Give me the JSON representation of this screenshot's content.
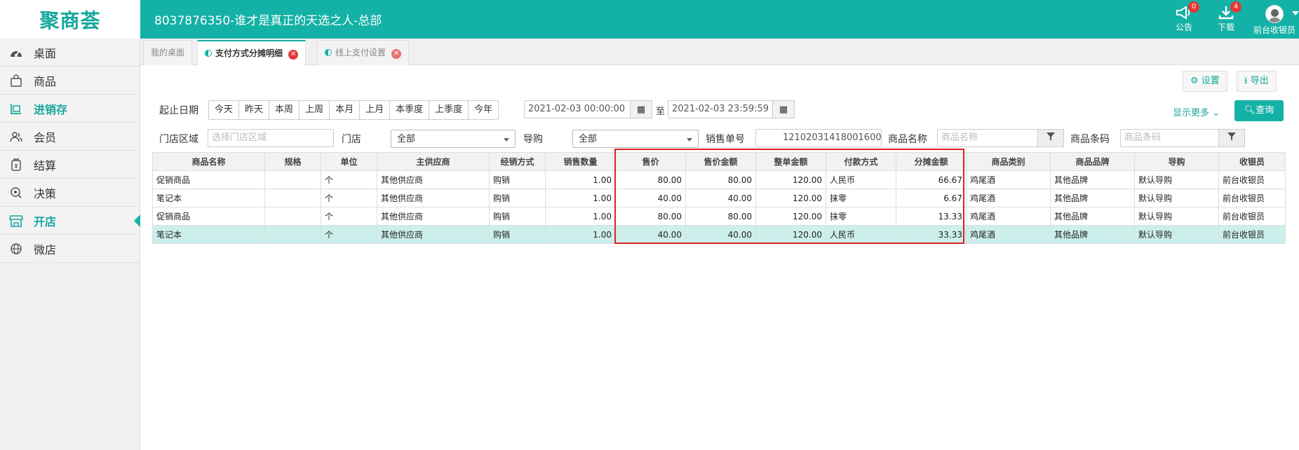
{
  "logo_text": "聚商荟",
  "app_title": "8037876350-谁才是真正的天选之人-总部",
  "topbar": {
    "notice": {
      "label": "公告",
      "badge": "0"
    },
    "download": {
      "label": "下载",
      "badge": "4"
    },
    "user": {
      "label": "前台收银员"
    }
  },
  "sidebar": {
    "items": [
      {
        "label": "桌面",
        "icon": "dashboard-icon"
      },
      {
        "label": "商品",
        "icon": "shopping-bag-icon"
      },
      {
        "label": "进销存",
        "icon": "inventory-icon"
      },
      {
        "label": "会员",
        "icon": "members-icon"
      },
      {
        "label": "结算",
        "icon": "settlement-icon"
      },
      {
        "label": "决策",
        "icon": "decision-icon"
      },
      {
        "label": "开店",
        "icon": "store-icon"
      },
      {
        "label": "微店",
        "icon": "globe-icon"
      }
    ]
  },
  "tabs": [
    {
      "label": "我的桌面"
    },
    {
      "label": "支付方式分摊明细"
    },
    {
      "label": "线上支付设置"
    }
  ],
  "toolbar": {
    "settings_label": "设置",
    "export_label": "导出"
  },
  "filters": {
    "date_label": "起止日期",
    "quick_dates": [
      "今天",
      "昨天",
      "本周",
      "上周",
      "本月",
      "上月",
      "本季度",
      "上季度",
      "今年"
    ],
    "start_date": "2021-02-03 00:00:00",
    "to_label": "至",
    "end_date": "2021-02-03 23:59:59",
    "more_label": "显示更多",
    "query_label": "查询",
    "region_label": "门店区域",
    "region_placeholder": "选择门店区域",
    "store_label": "门店",
    "store_value": "全部",
    "guide_label": "导购",
    "guide_value": "全部",
    "order_label": "销售单号",
    "order_value": "12102031418001600",
    "product_name_label": "商品名称",
    "product_name_placeholder": "商品名称",
    "barcode_label": "商品条码",
    "barcode_placeholder": "商品条码"
  },
  "table": {
    "headers": [
      "商品名称",
      "规格",
      "单位",
      "主供应商",
      "经销方式",
      "销售数量",
      "售价",
      "售价金额",
      "整单金额",
      "付款方式",
      "分摊金额",
      "商品类别",
      "商品品牌",
      "导购",
      "收银员"
    ],
    "rows": [
      [
        "促销商品",
        "",
        "个",
        "其他供应商",
        "购销",
        "1.00",
        "80.00",
        "80.00",
        "120.00",
        "人民币",
        "66.67",
        "鸡尾酒",
        "其他品牌",
        "默认导购",
        "前台收银员"
      ],
      [
        "笔记本",
        "",
        "个",
        "其他供应商",
        "购销",
        "1.00",
        "40.00",
        "40.00",
        "120.00",
        "抹零",
        "6.67",
        "鸡尾酒",
        "其他品牌",
        "默认导购",
        "前台收银员"
      ],
      [
        "促销商品",
        "",
        "个",
        "其他供应商",
        "购销",
        "1.00",
        "80.00",
        "80.00",
        "120.00",
        "抹零",
        "13.33",
        "鸡尾酒",
        "其他品牌",
        "默认导购",
        "前台收银员"
      ],
      [
        "笔记本",
        "",
        "个",
        "其他供应商",
        "购销",
        "1.00",
        "40.00",
        "40.00",
        "120.00",
        "人民币",
        "33.33",
        "鸡尾酒",
        "其他品牌",
        "默认导购",
        "前台收银员"
      ]
    ]
  },
  "colors": {
    "brand": "#14b1a6",
    "highlight_box": "#e02020",
    "selected_row": "#ccefec"
  }
}
